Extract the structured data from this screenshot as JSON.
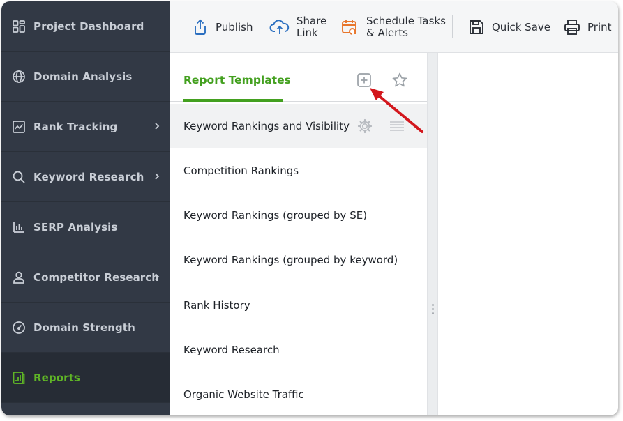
{
  "sidebar": {
    "items": [
      {
        "label": "Project Dashboard",
        "icon": "dashboard-grid-icon"
      },
      {
        "label": "Domain Analysis",
        "icon": "globe-icon"
      },
      {
        "label": "Rank Tracking",
        "icon": "line-chart-icon",
        "has_submenu": true
      },
      {
        "label": "Keyword Research",
        "icon": "search-icon",
        "has_submenu": true
      },
      {
        "label": "SERP Analysis",
        "icon": "bar-chart-icon"
      },
      {
        "label": "Competitor Research",
        "icon": "user-icon",
        "has_submenu": true
      },
      {
        "label": "Domain Strength",
        "icon": "gauge-icon"
      },
      {
        "label": "Reports",
        "icon": "report-icon",
        "active": true
      }
    ]
  },
  "toolbar": {
    "publish": "Publish",
    "share_line1": "Share",
    "share_line2": "Link",
    "schedule_line1": "Schedule Tasks",
    "schedule_line2": "& Alerts",
    "quick_save": "Quick Save",
    "print": "Print"
  },
  "templates_panel": {
    "title": "Report Templates",
    "rows": [
      "Keyword Rankings and Visibility",
      "Competition Rankings",
      "Keyword Rankings (grouped by SE)",
      "Keyword Rankings (grouped by keyword)",
      "Rank History",
      "Keyword Research",
      "Organic Website Traffic"
    ],
    "selected_index": 0
  },
  "colors": {
    "sidebar_bg": "#323945",
    "active_accent": "#5fb526",
    "panel_accent": "#43a01f",
    "schedule_icon": "#e8762c",
    "annotation_arrow": "#d3171d"
  }
}
